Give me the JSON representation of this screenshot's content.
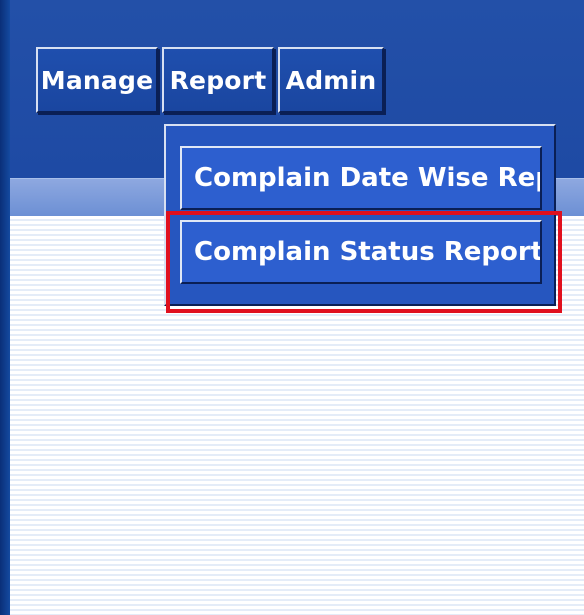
{
  "nav": {
    "items": [
      {
        "label": "Manage"
      },
      {
        "label": "Report"
      },
      {
        "label": "Admin"
      }
    ]
  },
  "report_menu": {
    "items": [
      {
        "label": "Complain Date Wise Report"
      },
      {
        "label": "Complain Status Report"
      }
    ],
    "highlighted_item": "Complain Status Report"
  },
  "colors": {
    "header": "#1e4aa4",
    "menu_item": "#2d5fcf",
    "highlight": "#e0101e"
  }
}
